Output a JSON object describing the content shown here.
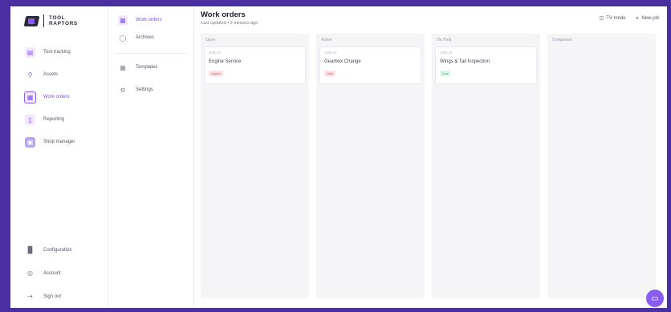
{
  "brand": {
    "name_line1": "TOOL",
    "name_line2": "RAPTORS"
  },
  "nav": {
    "items": [
      {
        "label": "Tool tracking",
        "icon": "tool-tracking-icon",
        "active": false
      },
      {
        "label": "Assets",
        "icon": "assets-icon",
        "active": false
      },
      {
        "label": "Work orders",
        "icon": "work-orders-icon",
        "active": true
      },
      {
        "label": "Reporting",
        "icon": "reporting-icon",
        "active": false
      },
      {
        "label": "Shop manager",
        "icon": "shop-manager-icon",
        "active": false
      }
    ],
    "bottom": [
      {
        "label": "Configuration",
        "icon": "configuration-icon"
      },
      {
        "label": "Account",
        "icon": "account-icon"
      },
      {
        "label": "Sign out",
        "icon": "sign-out-icon"
      }
    ]
  },
  "subnav": {
    "items": [
      {
        "label": "Work orders",
        "active": true
      },
      {
        "label": "Archives",
        "active": false
      },
      {
        "label": "Templates",
        "active": false
      },
      {
        "label": "Settings",
        "active": false
      }
    ]
  },
  "header": {
    "title": "Work orders",
    "subtitle": "Last updated • 2 minutes ago",
    "tv_mode": "TV mode",
    "new_job": "New job"
  },
  "columns": [
    {
      "title": "Open",
      "cards": [
        {
          "id": "JOB-41",
          "name": "Engine Service",
          "badge": "Urgent",
          "badge_color": "#e8534f",
          "badge_bg": "#fde3e3"
        }
      ]
    },
    {
      "title": "Active",
      "cards": [
        {
          "id": "JOB-42",
          "name": "Gearbox Change",
          "badge": "High",
          "badge_color": "#e8534f",
          "badge_bg": "#fde3e3"
        }
      ]
    },
    {
      "title": "On Hold",
      "cards": [
        {
          "id": "JOB-43",
          "name": "Wings & Tail Inspection",
          "badge": "Low",
          "badge_color": "#3aa86b",
          "badge_bg": "#ddf4e6"
        }
      ]
    },
    {
      "title": "Completed",
      "cards": []
    }
  ],
  "colors": {
    "accent": "#8a5cf6",
    "frame": "#4a2fa0"
  }
}
